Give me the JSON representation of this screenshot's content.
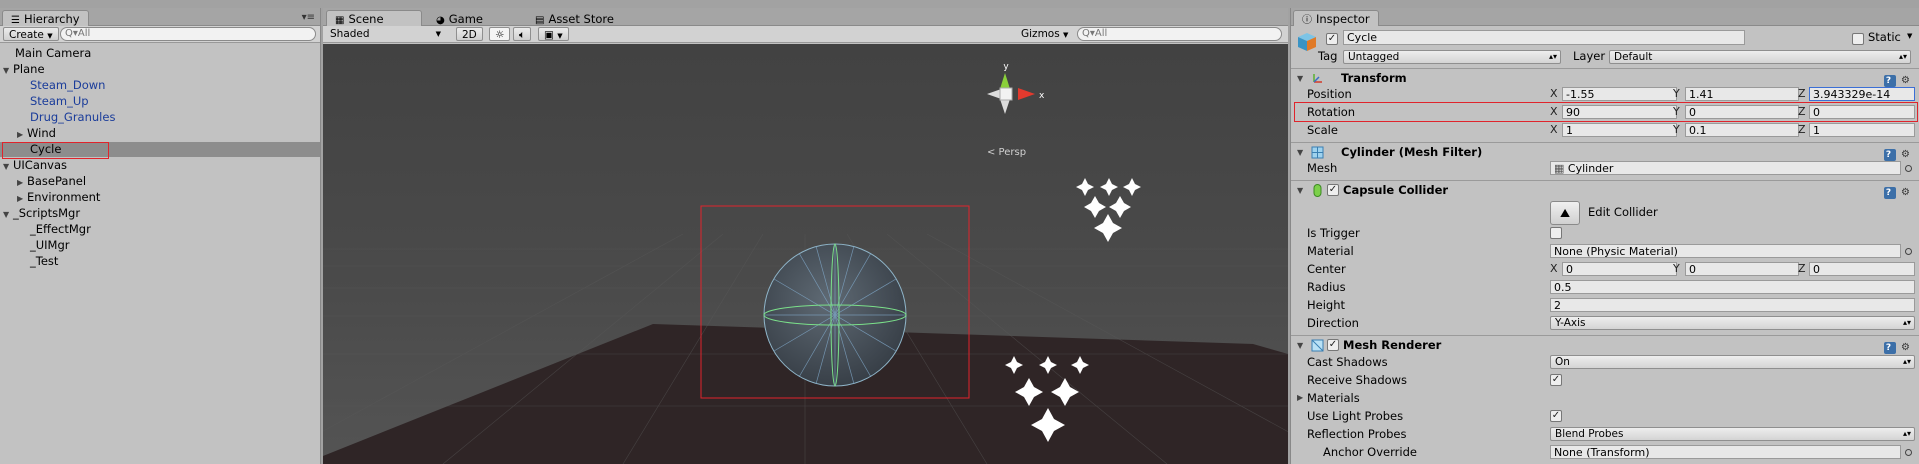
{
  "hierarchy": {
    "tab_label": "Hierarchy",
    "create_label": "Create",
    "search_placeholder": "Q▾All",
    "items": [
      {
        "label": "Main Camera"
      },
      {
        "label": "Plane"
      },
      {
        "label": "Steam_Down"
      },
      {
        "label": "Steam_Up"
      },
      {
        "label": "Drug_Granules"
      },
      {
        "label": "Wind"
      },
      {
        "label": "Cycle"
      },
      {
        "label": "UICanvas"
      },
      {
        "label": "BasePanel"
      },
      {
        "label": "Environment"
      },
      {
        "label": "_ScriptsMgr"
      },
      {
        "label": "_EffectMgr"
      },
      {
        "label": "_UIMgr"
      },
      {
        "label": "_Test"
      }
    ]
  },
  "scene": {
    "tabs": [
      {
        "label": "Scene",
        "icon": "scene-grid-icon"
      },
      {
        "label": "Game",
        "icon": "pacman-icon"
      },
      {
        "label": "Asset Store",
        "icon": "store-icon"
      }
    ],
    "shading_mode": "Shaded",
    "mode_2d": "2D",
    "gizmos_label": "Gizmos",
    "search_placeholder": "Q▾All",
    "persp_label": "< Persp",
    "gizmo_y": "y",
    "gizmo_x": "x"
  },
  "inspector": {
    "tab_label": "Inspector",
    "object_name": "Cycle",
    "static_label": "Static",
    "tag_label": "Tag",
    "tag_value": "Untagged",
    "layer_label": "Layer",
    "layer_value": "Default",
    "transform": {
      "title": "Transform",
      "position_label": "Position",
      "rotation_label": "Rotation",
      "scale_label": "Scale",
      "position": {
        "x": "-1.55",
        "y": "1.41",
        "z": "3.943329e-14"
      },
      "rotation": {
        "x": "90",
        "y": "0",
        "z": "0"
      },
      "scale": {
        "x": "1",
        "y": "0.1",
        "z": "1"
      }
    },
    "mesh_filter": {
      "title": "Cylinder (Mesh Filter)",
      "mesh_label": "Mesh",
      "mesh_value": "Cylinder"
    },
    "capsule_collider": {
      "title": "Capsule Collider",
      "edit_label": "Edit Collider",
      "is_trigger_label": "Is Trigger",
      "material_label": "Material",
      "material_value": "None (Physic Material)",
      "center_label": "Center",
      "center": {
        "x": "0",
        "y": "0",
        "z": "0"
      },
      "radius_label": "Radius",
      "radius_value": "0.5",
      "height_label": "Height",
      "height_value": "2",
      "direction_label": "Direction",
      "direction_value": "Y-Axis"
    },
    "mesh_renderer": {
      "title": "Mesh Renderer",
      "cast_shadows_label": "Cast Shadows",
      "cast_shadows_value": "On",
      "receive_shadows_label": "Receive Shadows",
      "materials_label": "Materials",
      "light_probes_label": "Use Light Probes",
      "reflection_probes_label": "Reflection Probes",
      "reflection_probes_value": "Blend Probes",
      "anchor_override_label": "Anchor Override",
      "anchor_override_value": "None (Transform)"
    },
    "axis_labels": {
      "x": "X",
      "y": "Y",
      "z": "Z"
    }
  },
  "colors": {
    "highlight_red": "#e0242c",
    "selection_gray": "#8d8d8d",
    "prefab_blue": "#1a3c9a",
    "panel_bg": "#c2c2c2"
  }
}
